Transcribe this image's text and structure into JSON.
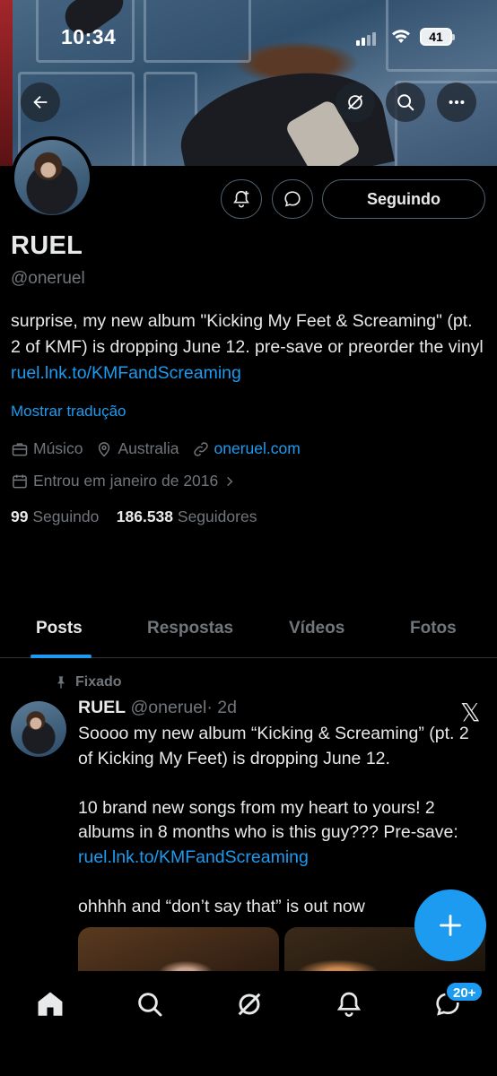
{
  "status_bar": {
    "time": "10:34",
    "battery": "41"
  },
  "header": {
    "back_icon": "arrow-left-icon",
    "actions": [
      "grok-icon",
      "search-icon",
      "more-icon"
    ]
  },
  "profile": {
    "name": "RUEL",
    "handle": "@oneruel",
    "bio_text": "surprise, my new album \"Kicking My Feet & Screaming\" (pt. 2 of KMF) is dropping June 12. pre-save or preorder the vinyl ",
    "bio_link": "ruel.lnk.to/KMFandScreaming",
    "translate_label": "Mostrar tradução",
    "category": "Músico",
    "location": "Australia",
    "website": "oneruel.com",
    "joined": "Entrou em janeiro de 2016",
    "following_count": "99",
    "following_label": "Seguindo",
    "followers_count": "186.538",
    "followers_label": "Seguidores",
    "follow_button": "Seguindo"
  },
  "tabs": [
    "Posts",
    "Respostas",
    "Vídeos",
    "Fotos"
  ],
  "tweet": {
    "pinned_label": "Fixado",
    "author_name": "RUEL",
    "author_handle": "@oneruel",
    "time": "· 2d",
    "para1": "Soooo my new album “Kicking & Screaming” (pt. 2 of Kicking My Feet) is dropping June 12.",
    "para2_text": "10 brand new songs from my heart to yours! 2 albums in 8 months who is this guy??? Pre-save: ",
    "para2_link": "ruel.lnk.to/KMFandScreaming",
    "para3": "ohhhh and “don’t say that” is out now"
  },
  "bottom_nav": {
    "items": [
      "home-icon",
      "search-icon",
      "grok-icon",
      "notifications-icon",
      "messages-icon"
    ],
    "messages_badge": "20+"
  },
  "colors": {
    "accent": "#1d9bf0",
    "background": "#000000",
    "muted": "#71767b"
  }
}
